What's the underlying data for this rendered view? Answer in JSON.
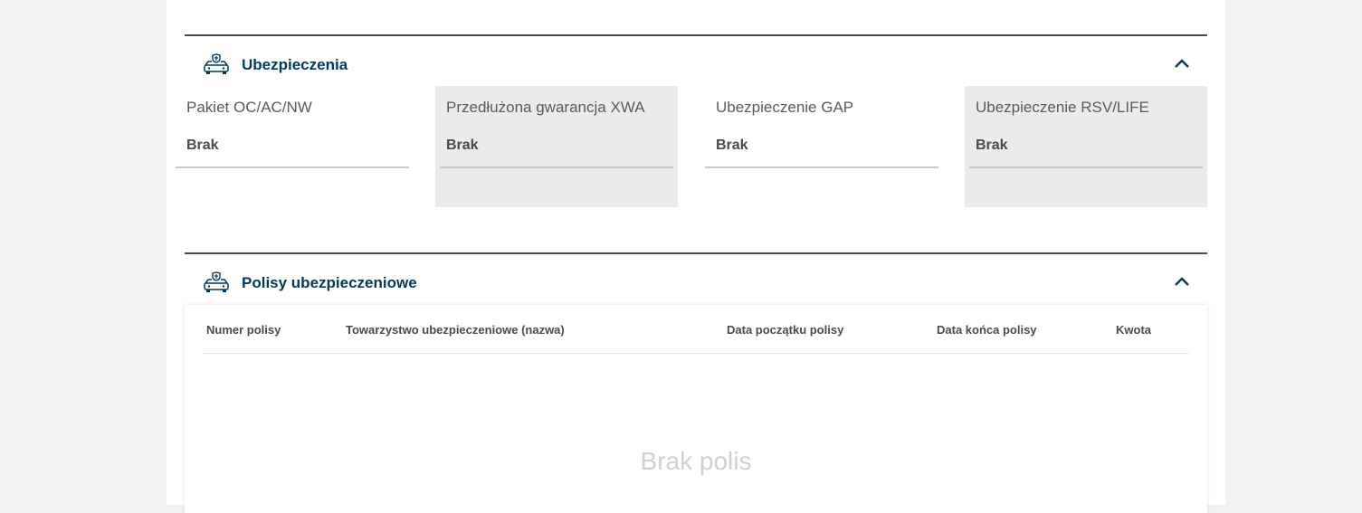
{
  "insurance": {
    "title": "Ubezpieczenia",
    "icon": "car-shield-icon",
    "fields": [
      {
        "label": "Pakiet OC/AC/NW",
        "value": "Brak"
      },
      {
        "label": "Przedłużona gwarancja XWA",
        "value": "Brak"
      },
      {
        "label": "Ubezpieczenie GAP",
        "value": "Brak"
      },
      {
        "label": "Ubezpieczenie RSV/LIFE",
        "value": "Brak"
      }
    ]
  },
  "policies": {
    "title": "Polisy ubezpieczeniowe",
    "icon": "car-shield-icon",
    "columns": [
      "Numer polisy",
      "Towarzystwo ubezpieczeniowe (nazwa)",
      "Data początku polisy",
      "Data końca polisy",
      "Kwota"
    ],
    "empty_message": "Brak polis"
  },
  "colors": {
    "accent": "#003a5c",
    "page_bg": "#f1f1f1",
    "shaded_field": "#eaeceb"
  }
}
